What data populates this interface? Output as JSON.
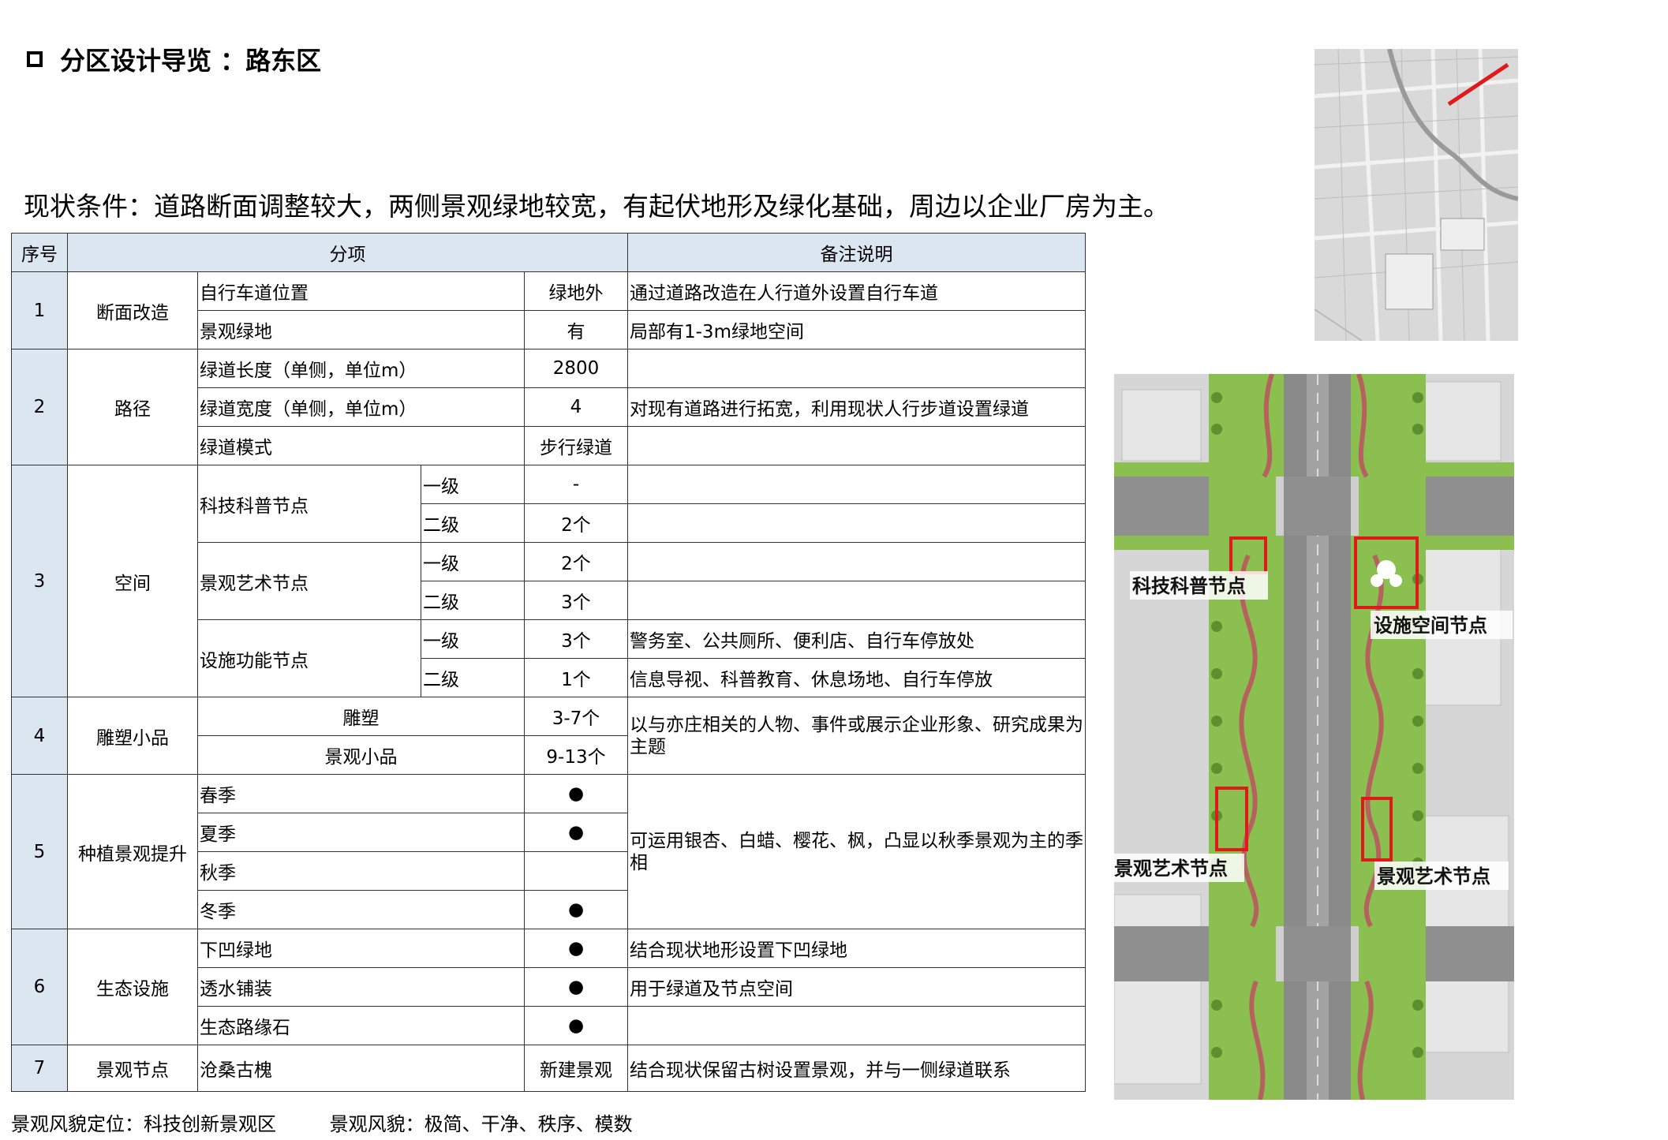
{
  "header": {
    "title": "分区设计导览 ：路东区"
  },
  "status_text": "现状条件：道路断面调整较大，两侧景观绿地较宽，有起伏地形及绿化基础，周边以企业厂房为主。",
  "table": {
    "headers": {
      "no": "序号",
      "item": "分项",
      "note": "备注说明"
    },
    "r1": {
      "no": "1",
      "cat": "断面改造",
      "a": {
        "label": "自行车道位置",
        "value": "绿地外",
        "note": "通过道路改造在人行道外设置自行车道"
      },
      "b": {
        "label": "景观绿地",
        "value": "有",
        "note": "局部有1-3m绿地空间"
      }
    },
    "r2": {
      "no": "2",
      "cat": "路径",
      "a": {
        "label": "绿道长度（单侧，单位m）",
        "value": "2800",
        "note": ""
      },
      "b": {
        "label": "绿道宽度（单侧，单位m）",
        "value": "4",
        "note": "对现有道路进行拓宽，利用现状人行步道设置绿道"
      },
      "c": {
        "label": "绿道模式",
        "value": "步行绿道",
        "note": ""
      }
    },
    "r3": {
      "no": "3",
      "cat": "空间",
      "g1": {
        "label": "科技科普节点",
        "l1": "一级",
        "v1": "-",
        "n1": "",
        "l2": "二级",
        "v2": "2个",
        "n2": ""
      },
      "g2": {
        "label": "景观艺术节点",
        "l1": "一级",
        "v1": "2个",
        "n1": "",
        "l2": "二级",
        "v2": "3个",
        "n2": ""
      },
      "g3": {
        "label": "设施功能节点",
        "l1": "一级",
        "v1": "3个",
        "n1": "警务室、公共厕所、便利店、自行车停放处",
        "l2": "二级",
        "v2": "1个",
        "n2": "信息导视、科普教育、休息场地、自行车停放"
      }
    },
    "r4": {
      "no": "4",
      "cat": "雕塑小品",
      "a": {
        "label": "雕塑",
        "value": "3-7个"
      },
      "b": {
        "label": "景观小品",
        "value": "9-13个"
      },
      "note": "以与亦庄相关的人物、事件或展示企业形象、研究成果为主题"
    },
    "r5": {
      "no": "5",
      "cat": "种植景观提升",
      "spring": {
        "label": "春季",
        "value": "●"
      },
      "summer": {
        "label": "夏季",
        "value": "●"
      },
      "autumn": {
        "label": "秋季",
        "value": ""
      },
      "winter": {
        "label": "冬季",
        "value": "●"
      },
      "note": "可运用银杏、白蜡、樱花、枫，凸显以秋季景观为主的季相"
    },
    "r6": {
      "no": "6",
      "cat": "生态设施",
      "a": {
        "label": "下凹绿地",
        "value": "●",
        "note": "结合现状地形设置下凹绿地"
      },
      "b": {
        "label": "透水铺装",
        "value": "●",
        "note": "用于绿道及节点空间"
      },
      "c": {
        "label": "生态路缘石",
        "value": "●",
        "note": ""
      }
    },
    "r7": {
      "no": "7",
      "cat": "景观节点",
      "label": "沧桑古槐",
      "value": "新建景观",
      "note": "结合现状保留古树设置景观，并与一侧绿道联系"
    }
  },
  "footer": {
    "position": "景观风貌定位：科技创新景观区",
    "style": "景观风貌：极简、干净、秩序、模数"
  },
  "plan": {
    "labels": {
      "sci": "科技科普节点",
      "facility": "设施空间节点",
      "art_left": "景观艺术节点",
      "art_right": "景观艺术节点"
    }
  },
  "colors": {
    "header_fill": "#dce6f1",
    "highlight": "#e0191b",
    "green": "#7cb342",
    "road": "#8a8a8a"
  }
}
